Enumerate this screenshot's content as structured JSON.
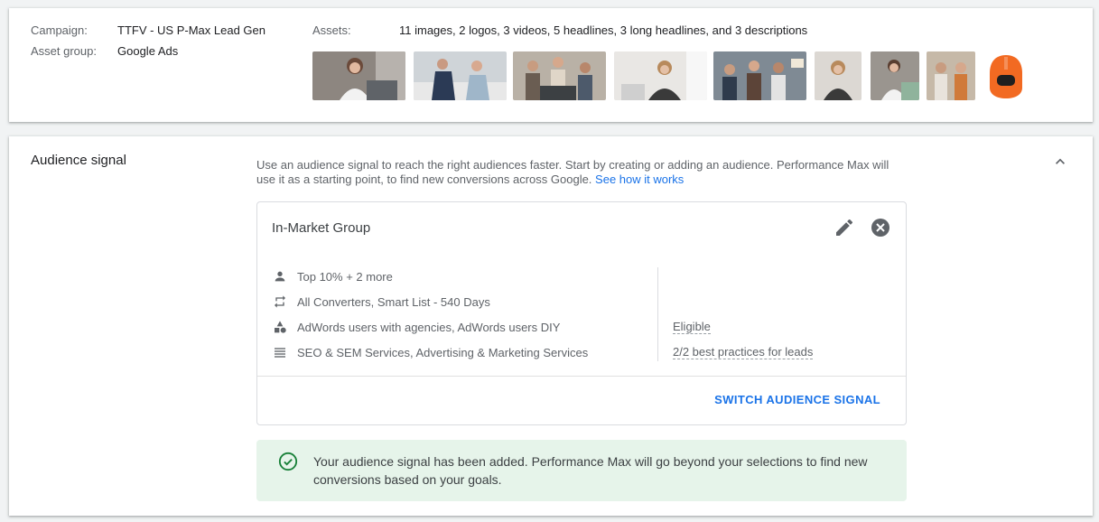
{
  "summary": {
    "campaign_label": "Campaign:",
    "campaign_value": "TTFV - US P-Max Lead Gen",
    "asset_group_label": "Asset group:",
    "asset_group_value": "Google Ads",
    "assets_label": "Assets:",
    "assets_value": "11 images, 2 logos, 3 videos, 5 headlines, 3 long headlines, and 3 descriptions"
  },
  "audience_signal": {
    "title": "Audience signal",
    "description": "Use an audience signal to reach the right audiences faster. Start by creating or adding an audience. Performance Max will use it as a starting point, to find new conversions across Google.",
    "help_link": "See how it works",
    "group": {
      "name": "In-Market Group",
      "rows": [
        {
          "icon": "person-icon",
          "text": "Top 10% + 2 more"
        },
        {
          "icon": "repeat-icon",
          "text": "All Converters, Smart List - 540 Days"
        },
        {
          "icon": "shapes-icon",
          "text": "AdWords users with agencies, AdWords users DIY"
        },
        {
          "icon": "list-icon",
          "text": "SEO & SEM Services, Advertising & Marketing Services"
        }
      ],
      "status": "Eligible",
      "best_practices": "2/2 best practices for leads"
    },
    "switch_button": "SWITCH AUDIENCE SIGNAL",
    "notice": "Your audience signal has been added. Performance Max will go beyond your selections to find new conversions based on your goals."
  },
  "colors": {
    "accent": "#1a73e8",
    "notice_bg": "#e6f4ea",
    "success": "#188038"
  }
}
